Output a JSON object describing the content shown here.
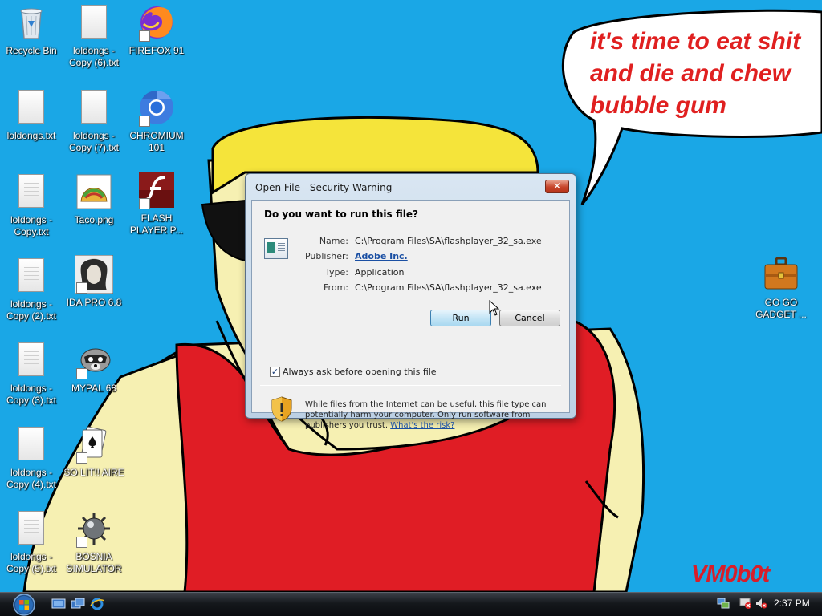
{
  "wallpaper": {
    "speech_text": "it's time to eat shit\nand die and chew\nbubble gum",
    "signature": "VM0b0t"
  },
  "desktop_icons": [
    {
      "label": "Recycle Bin",
      "icon": "recycle-bin-icon"
    },
    {
      "label": "loldongs - Copy (6).txt",
      "icon": "text-file-icon"
    },
    {
      "label": "FIREFOX 91",
      "icon": "firefox-icon"
    },
    {
      "label": "loldongs.txt",
      "icon": "text-file-icon"
    },
    {
      "label": "loldongs - Copy (7).txt",
      "icon": "text-file-icon"
    },
    {
      "label": "CHROMIUM 101",
      "icon": "chromium-icon"
    },
    {
      "label": "loldongs - Copy.txt",
      "icon": "text-file-icon"
    },
    {
      "label": "Taco.png",
      "icon": "taco-image-icon"
    },
    {
      "label": "FLASH PLAYER P...",
      "icon": "flash-player-icon"
    },
    {
      "label": "loldongs - Copy (2).txt",
      "icon": "text-file-icon"
    },
    {
      "label": "IDA PRO 6.8",
      "icon": "ida-pro-icon"
    },
    {
      "label": "loldongs - Copy (3).txt",
      "icon": "text-file-icon"
    },
    {
      "label": "MYPAL 68",
      "icon": "mypal-raccoon-icon"
    },
    {
      "label": "loldongs - Copy (4).txt",
      "icon": "text-file-icon"
    },
    {
      "label": "SO LIT!! AIRE",
      "icon": "solitaire-cards-icon"
    },
    {
      "label": "loldongs - Copy (5).txt",
      "icon": "text-file-icon"
    },
    {
      "label": "BOSNIA SIMULATOR",
      "icon": "minesweeper-mine-icon"
    },
    {
      "label": "GO GO GADGET ...",
      "icon": "briefcase-icon"
    }
  ],
  "dialog": {
    "title": "Open File - Security Warning",
    "close_label": "✕",
    "question": "Do you want to run this file?",
    "fields": [
      {
        "key": "Name:",
        "value": "C:\\Program Files\\SA\\flashplayer_32_sa.exe"
      },
      {
        "key": "Publisher:",
        "value": "Adobe Inc."
      },
      {
        "key": "Type:",
        "value": "Application"
      },
      {
        "key": "From:",
        "value": "C:\\Program Files\\SA\\flashplayer_32_sa.exe"
      }
    ],
    "run_label": "Run",
    "cancel_label": "Cancel",
    "checkbox_label": "Always ask before opening this file",
    "checkbox_checked": true,
    "checkbox_mark": "✓",
    "warning_text": "While files from the Internet can be useful, this file type can potentially harm your computer. Only run software from publishers you trust.",
    "warning_link": "What's the risk?"
  },
  "taskbar": {
    "clock": "2:37 PM",
    "quick_launch": [
      "show-desktop-icon",
      "switch-windows-icon",
      "internet-explorer-icon"
    ],
    "tray": [
      "network-icon",
      "connection-warning-icon",
      "volume-muted-icon"
    ]
  },
  "colors": {
    "desktop": "#1aa7e6",
    "speech_text": "#e02020",
    "hair": "#f5e43a",
    "shirt": "#e01d25",
    "skin": "#f6f0b2"
  }
}
